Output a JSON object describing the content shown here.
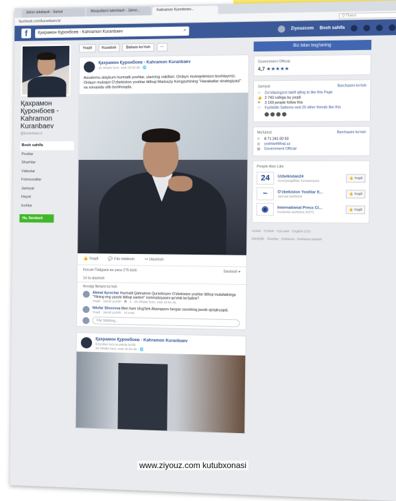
{
  "browser": {
    "tabs": [
      {
        "label": "Jahon adabiyoti - Samal"
      },
      {
        "label": "Mavjudlarni tahririlash - Jahon..."
      },
      {
        "label": "Kahramon Kuronboev..."
      }
    ],
    "url": "facebook.com/kuranbaev.b/",
    "search_placeholder": "Q Поиск"
  },
  "fb": {
    "search_value": "Қахрамон Куронбоев - Kahramon Kuranbaev",
    "user": "Ziyouzcom",
    "home": "Bosh sahifa"
  },
  "profile": {
    "name": "Қахрамон Қуронбоев - Kahramon Kuranbaev",
    "handle": "@kuranbaev.k",
    "nav": [
      "Bosh sahifa",
      "Postlar",
      "Sharhlar",
      "Videolar",
      "Fotosuratlar",
      "Jamiyat",
      "Hayat",
      "Izohlar"
    ],
    "green_button": "Ha, Saralash"
  },
  "action_bar": {
    "like": "Yoqdi",
    "follow": "Kuzatish",
    "share": "Baham ko'rish",
    "more": "···"
  },
  "post1": {
    "author": "Қахрамон Қуронбоев - Kahramon Kuranbaev",
    "date": "26 Oktabr kuni, soat 15:34 da · 🌐",
    "text": "Assalomu alaykum hurmatli yoshlar, ularning vakillari. Onlayn muloqotimizni boshlaymiz. Onlayn muloqot O'zbekiston yoshlar ittifoqi Markaziy Kengashining \"Harakatlar strategiyasi\" va xonasida olib borilmoqda.",
    "actions": {
      "like": "Yoqdi",
      "comment": "Fikr bildirish",
      "share": "Ulashish"
    },
    "reactions": "Касым Пайдаев ва yana 276 kishi",
    "sort": "Saralash ▾",
    "shares": "14 ta ulashish",
    "comments_top": "Avvalgi fikrlarni ko'rish",
    "comments": [
      {
        "author": "Akmal Ayrochar",
        "text": "Hurmatli Qahramon Quranboyev O'zbekiston yoshlar ittifoqi mutafakkiriga \"Yilning eng yaxshi ittifoqi sardori\" nominatsiyasini qo'shib bo'ladimi?",
        "meta": "Yoqdi · Javob yozish · ❶ · 2 · 26 Oktabr kuni, soat 15:52 da"
      },
      {
        "author": "Nilufar Shoxrova",
        "text": "Men ham Ulug'bek Abanqazov bergan savolning javobi qiziqtiryapdi.",
        "meta": "Yoqdi · Javob yozish · 14 soat"
      }
    ],
    "comment_placeholder": "Fikr bildiring..."
  },
  "post2": {
    "author": "Қахрамон Қуронбоев - Kahramon Kuranbaev",
    "sub": "bo'g'idan ko'p ta ekkda bo'ldi",
    "date": "26 Oktabr kuni, soat 15:02 da · 🌐"
  },
  "right": {
    "message_button": "Biz bilan bog'laning",
    "gov": {
      "label": "Government Official",
      "rating": "4,7",
      "stars": "★★★★★"
    },
    "community": {
      "title": "Jamiyat",
      "link": "Barchasini ko'rish",
      "invite": "Do'stlaringizni taklif qiling to like this Page",
      "likes": "2 743 nafriga bu yoqdi",
      "follows": "3 169 people follow this",
      "friends": "Fazliddin Sattorov and 20 other friends like this"
    },
    "info": {
      "title": "Ma'lumot",
      "link": "Barchasini ko'rish",
      "phone": "8 71 241 00 50",
      "site": "yoshlarittifoqi.uz",
      "category": "Government Official"
    },
    "also_like": {
      "title": "People Also Like",
      "pages": [
        {
          "logo": "24",
          "name": "Uzbekistan24",
          "sub": "OAV/yangiliklar kompaniyasi",
          "btn": "Yoqdi"
        },
        {
          "logo": "~",
          "name": "O'zbekiston Yoshlar It...",
          "sub": "Jamoat tashkiloti",
          "btn": "Yoqdi"
        },
        {
          "logo": "◉",
          "name": "International Press Cl...",
          "sub": "Nodavlat tashkiloti (NDT)",
          "btn": "Yoqdi"
        }
      ]
    },
    "footer": "Uzbek · O'zbek · Русский · English (US)",
    "footer2": "Maxfiylik · Shartlar · Reklama · Reklama tanlash"
  },
  "watermark": "www.ziyouz.com kutubxonasi"
}
